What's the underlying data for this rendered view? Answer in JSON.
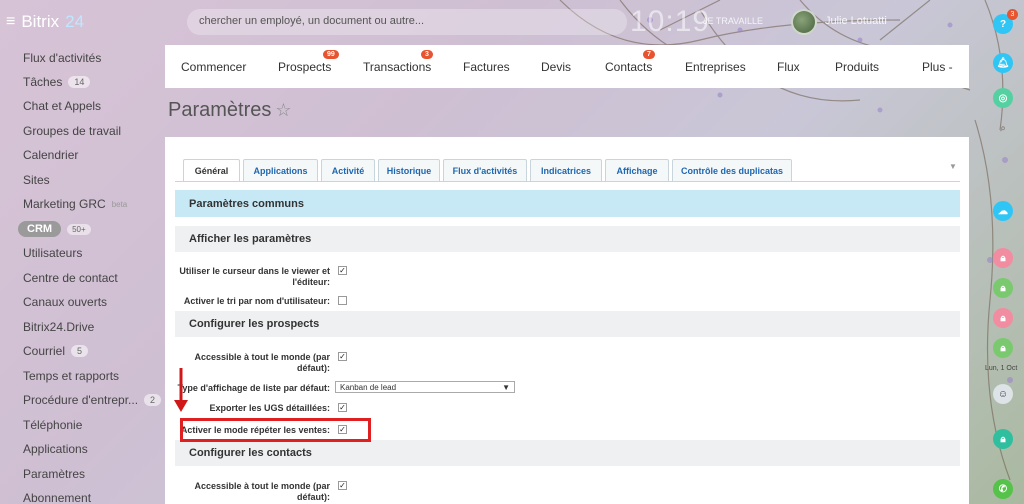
{
  "topbar": {
    "brand": "Bitrix",
    "brand_num": "24",
    "search_placeholder": "chercher un employé, un document ou autre...",
    "clock": "10:19",
    "work_status": "JE TRAVAILLE",
    "user_name": "Julie Lotuatti"
  },
  "sidebar": {
    "items": [
      {
        "label": "Flux d'activités"
      },
      {
        "label": "Tâches",
        "count": "14"
      },
      {
        "label": "Chat et Appels"
      },
      {
        "label": "Groupes de travail"
      },
      {
        "label": "Calendrier"
      },
      {
        "label": "Sites"
      },
      {
        "label": "Marketing GRC",
        "sup": "beta"
      },
      {
        "label": "CRM",
        "count": "50+"
      },
      {
        "label": "Utilisateurs"
      },
      {
        "label": "Centre de contact"
      },
      {
        "label": "Canaux ouverts"
      },
      {
        "label": "Bitrix24.Drive"
      },
      {
        "label": "Courriel",
        "count": "5"
      },
      {
        "label": "Temps et rapports"
      },
      {
        "label": "Procédure d'entrepr...",
        "count": "2"
      },
      {
        "label": "Téléphonie"
      },
      {
        "label": "Applications"
      },
      {
        "label": "Paramètres"
      },
      {
        "label": "Abonnement"
      }
    ]
  },
  "nav": {
    "items": [
      {
        "label": "Commencer"
      },
      {
        "label": "Prospects",
        "badge": "99"
      },
      {
        "label": "Transactions",
        "badge": "3"
      },
      {
        "label": "Factures"
      },
      {
        "label": "Devis"
      },
      {
        "label": "Contacts",
        "badge": "7"
      },
      {
        "label": "Entreprises"
      },
      {
        "label": "Flux"
      },
      {
        "label": "Produits"
      },
      {
        "label": "Plus -"
      }
    ]
  },
  "page": {
    "title": "Paramètres",
    "star": "☆"
  },
  "tabs": [
    {
      "label": "Général",
      "active": true
    },
    {
      "label": "Applications"
    },
    {
      "label": "Activité"
    },
    {
      "label": "Historique"
    },
    {
      "label": "Flux d'activités"
    },
    {
      "label": "Indicatrices"
    },
    {
      "label": "Affichage"
    },
    {
      "label": "Contrôle des duplicatas"
    }
  ],
  "sections": {
    "common": "Paramètres communs",
    "display": "Afficher les paramètres",
    "prospects": "Configurer les prospects",
    "contacts": "Configurer les contacts"
  },
  "fields": {
    "cursor_viewer": {
      "label": "Utiliser le curseur dans le viewer et l'éditeur:",
      "checked": true
    },
    "sort_username": {
      "label": "Activer le tri par nom d'utilisateur:",
      "checked": false
    },
    "prospects_public": {
      "label": "Accessible à tout le monde (par défaut):",
      "checked": true
    },
    "list_display_type": {
      "label": "Type d'affichage de liste par défaut:",
      "value": "Kanban de lead"
    },
    "export_ugs": {
      "label": "Exporter les UGS détaillées:",
      "checked": true
    },
    "repeat_sales": {
      "label": "Activer le mode répéter les ventes:",
      "checked": true
    },
    "contacts_public": {
      "label": "Accessible à tout le monde (par défaut):",
      "checked": true
    }
  },
  "rail": {
    "help_badge": "3",
    "date": "Lun, 1 Oct"
  },
  "colors": {
    "accent_blue": "#2067b0",
    "section_blue": "#c7e9f6",
    "badge_red": "#e8542f",
    "highlight_red": "#e02020"
  }
}
